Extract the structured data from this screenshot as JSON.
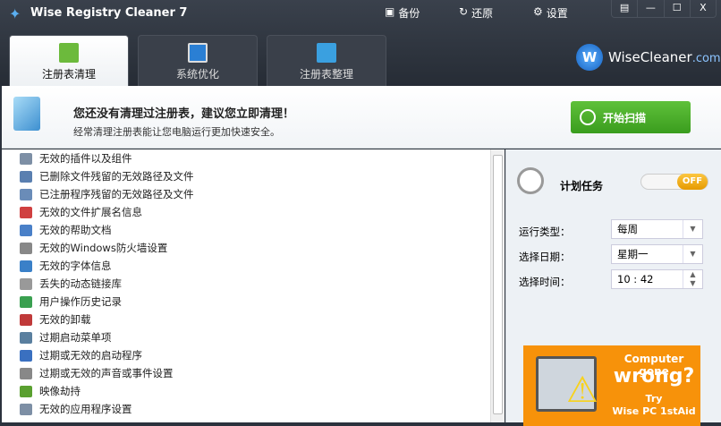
{
  "app": {
    "title": "Wise Registry Cleaner 7"
  },
  "toolbar": {
    "backup": "备份",
    "restore": "还原",
    "settings": "设置"
  },
  "window": {
    "menu": "▤",
    "minimize": "—",
    "maximize": "☐",
    "close": "X"
  },
  "tabs": [
    {
      "label": "注册表清理"
    },
    {
      "label": "系统优化"
    },
    {
      "label": "注册表整理"
    }
  ],
  "brand": {
    "mark": "W",
    "name": "WiseCleaner",
    "suffix": ".com"
  },
  "banner": {
    "title": "您还没有清理过注册表，建议您立即清理！",
    "subtitle": "经常清理注册表能让您电脑运行更加快速安全。",
    "scan_button": "开始扫描"
  },
  "items": [
    "无效的插件以及组件",
    "已删除文件残留的无效路径及文件",
    "已注册程序残留的无效路径及文件",
    "无效的文件扩展名信息",
    "无效的帮助文档",
    "无效的Windows防火墙设置",
    "无效的字体信息",
    "丢失的动态链接库",
    "用户操作历史记录",
    "无效的卸载",
    "过期启动菜单项",
    "过期或无效的启动程序",
    "过期或无效的声音或事件设置",
    "映像劫持",
    "无效的应用程序设置"
  ],
  "schedule": {
    "title": "计划任务",
    "toggle": "OFF",
    "run_type_label": "运行类型：",
    "run_type": "每周",
    "date_label": "选择日期：",
    "date": "星期一",
    "time_label": "选择时间：",
    "time": "10 : 42"
  },
  "ad": {
    "line1": "Computer gone",
    "line2": "wrong?",
    "line3": "Try",
    "line4": "Wise PC 1stAid"
  }
}
